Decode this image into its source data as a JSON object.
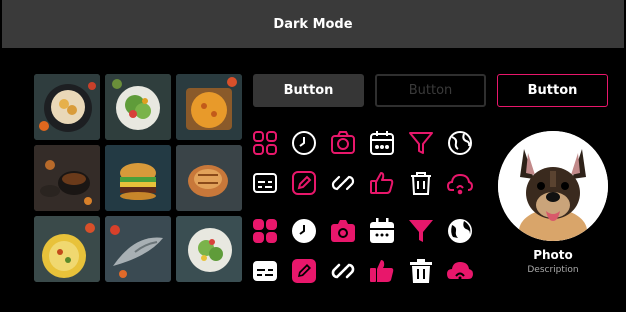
{
  "header": {
    "title": "Dark Mode"
  },
  "gallery": {
    "images": [
      {
        "name": "pasta-plate"
      },
      {
        "name": "salad-bowl"
      },
      {
        "name": "pizza-board"
      },
      {
        "name": "tea-cups"
      },
      {
        "name": "burger"
      },
      {
        "name": "bread-loaf"
      },
      {
        "name": "pilaf-plate"
      },
      {
        "name": "fish"
      },
      {
        "name": "salad-plate"
      }
    ]
  },
  "buttons": {
    "filled": "Button",
    "disabled": "Button",
    "outline": "Button"
  },
  "icons": {
    "outline_row1": [
      "apps-icon",
      "clock-icon",
      "camera-icon",
      "calendar-icon",
      "filter-icon",
      "globe-icon"
    ],
    "outline_row2": [
      "subtitles-icon",
      "edit-icon",
      "link-icon",
      "thumbs-up-icon",
      "trash-icon",
      "cloud-wifi-icon"
    ],
    "solid_row1": [
      "apps-icon",
      "clock-icon",
      "camera-icon",
      "calendar-icon",
      "filter-icon",
      "globe-icon"
    ],
    "solid_row2": [
      "subtitles-icon",
      "edit-icon",
      "link-icon",
      "thumbs-up-icon",
      "trash-icon",
      "cloud-wifi-icon"
    ]
  },
  "colors": {
    "accent": "#e8176b",
    "background": "#000000",
    "header": "#3a3a3a",
    "button_dark": "#363636"
  },
  "profile": {
    "name": "Photo",
    "description": "Description"
  }
}
